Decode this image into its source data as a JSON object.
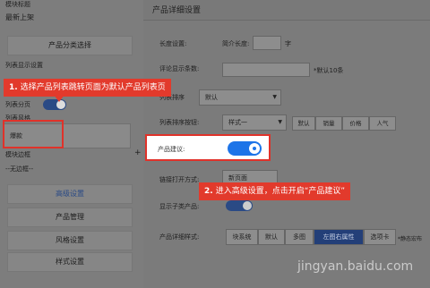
{
  "left": {
    "module_title_label": "模块标题",
    "module_title_value": "最新上架",
    "category_button": "产品分类选择",
    "list_display_label": "列表显示设置",
    "list_paging_label": "列表分页",
    "list_style_label": "列表风格",
    "style_value": "爆款",
    "module_border_label": "模块边框",
    "border_value": "--无边框--",
    "plus": "+",
    "buttons": [
      "高级设置",
      "产品管理",
      "风格设置",
      "样式设置"
    ]
  },
  "dialog": {
    "title": "产品详细设置",
    "length_label": "长度设置:",
    "length_prefix": "简介长度:",
    "length_unit": "字",
    "comment_label": "评论显示条数:",
    "comment_hint": "*默认10条",
    "list_sort_label": "列表排序",
    "list_sort_value": "默认",
    "sort_button_label": "列表排序按钮:",
    "sort_style_value": "样式一",
    "sort_buttons": [
      "默认",
      "销量",
      "价格",
      "人气"
    ],
    "product_suggest_label": "产品建议:",
    "link_open_label": "链接打开方式:",
    "link_open_value": "新页面",
    "show_subcat_label": "显示子类产品:",
    "detail_style_label": "产品详细样式:",
    "detail_style_options": [
      "块系统",
      "默认",
      "多图",
      "左图右属性",
      "选项卡"
    ],
    "detail_style_hint": "*静态宏布"
  },
  "annotations": {
    "step1": {
      "num": "1.",
      "text": "选择产品列表跳转页面为默认产品列表页"
    },
    "step2": {
      "num": "2.",
      "text": "进入高级设置，点击开启“产品建议”"
    }
  },
  "watermark": "jingyan.baidu.com",
  "colors": {
    "accent": "#1d74e8",
    "callout": "#e23a2c",
    "active_segment": "#233f78"
  }
}
